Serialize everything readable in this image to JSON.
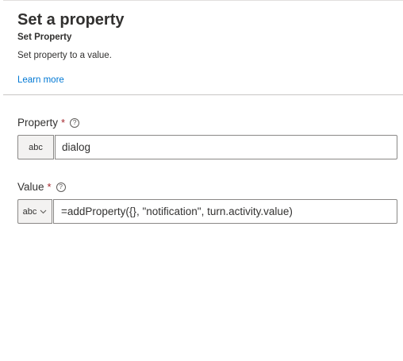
{
  "header": {
    "title": "Set a property",
    "subtitle": "Set Property",
    "description": "Set property to a value.",
    "learn_more": "Learn more"
  },
  "fields": {
    "property": {
      "label": "Property",
      "required_mark": "*",
      "help_glyph": "?",
      "type_label": "abc",
      "value": "dialog"
    },
    "value": {
      "label": "Value",
      "required_mark": "*",
      "help_glyph": "?",
      "type_label": "abc",
      "value": "=addProperty({}, \"notification\", turn.activity.value)"
    }
  },
  "colors": {
    "link": "#0078d4",
    "required": "#a4262c",
    "border": "#8a8886",
    "type_bg": "#f3f2f1"
  }
}
